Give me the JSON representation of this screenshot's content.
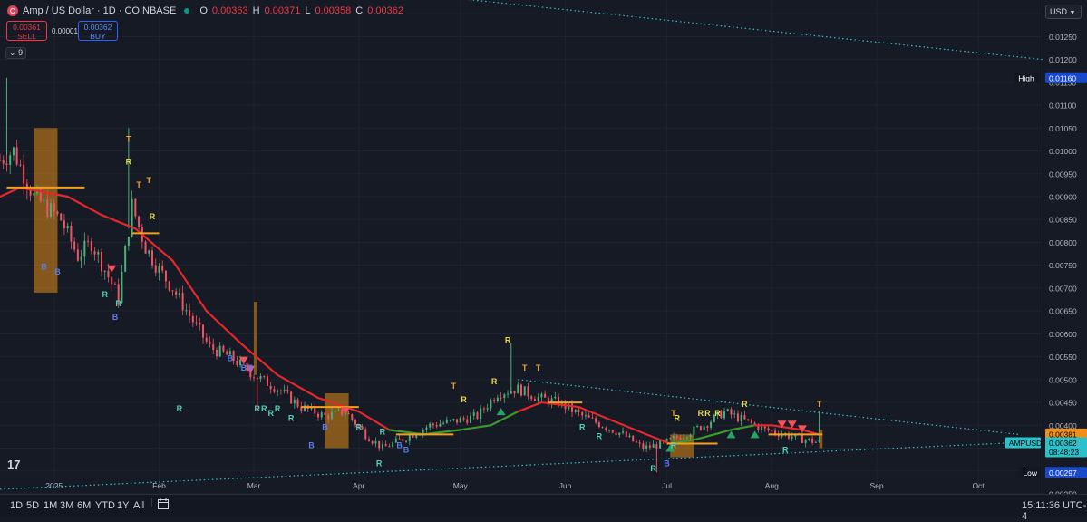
{
  "symbol": {
    "title": "Amp / US Dollar · 1D · COINBASE",
    "open_label": "O",
    "open": "0.00363",
    "high_label": "H",
    "high": "0.00371",
    "low_label": "L",
    "low": "0.00358",
    "close_label": "C",
    "close": "0.00362"
  },
  "trade": {
    "sell_price": "0.00361",
    "sell_label": "SELL",
    "spread": "0.00001",
    "buy_price": "0.00362",
    "buy_label": "BUY"
  },
  "indicator_count": "9",
  "currency_button": "USD",
  "colors": {
    "background": "#161a25",
    "up": "#4caf78",
    "down": "#f05463",
    "ma_down": "#e3282b",
    "ma_up": "#3a9a2a",
    "box": "#e08a16",
    "dotted": "#2ec0c8",
    "sell_marker": "#f0525e",
    "buy_marker": "#22a866"
  },
  "chart_data": {
    "type": "candlestick",
    "title": "Amp / US Dollar · 1D · COINBASE",
    "ylim": [
      0.0025,
      0.0133
    ],
    "x_range": [
      "2024-12-16",
      "2025-10-20"
    ],
    "grid": true,
    "y_ticks": [
      "0.01300",
      "0.01250",
      "0.01200",
      "0.01150",
      "0.01100",
      "0.01050",
      "0.01000",
      "0.00950",
      "0.00900",
      "0.00850",
      "0.00800",
      "0.00750",
      "0.00700",
      "0.00650",
      "0.00600",
      "0.00550",
      "0.00500",
      "0.00450",
      "0.00400",
      "0.00350",
      "0.00300",
      "0.00250"
    ],
    "x_ticks": [
      {
        "label": "2025",
        "date": "2025-01-01"
      },
      {
        "label": "Feb",
        "date": "2025-02-01"
      },
      {
        "label": "Mar",
        "date": "2025-03-01"
      },
      {
        "label": "Apr",
        "date": "2025-04-01"
      },
      {
        "label": "May",
        "date": "2025-05-01"
      },
      {
        "label": "Jun",
        "date": "2025-06-01"
      },
      {
        "label": "Jul",
        "date": "2025-07-01"
      },
      {
        "label": "Aug",
        "date": "2025-08-01"
      },
      {
        "label": "Sep",
        "date": "2025-09-01"
      },
      {
        "label": "Oct",
        "date": "2025-10-01"
      }
    ],
    "price_path": [
      [
        "2024-12-16",
        0.0098
      ],
      [
        "2024-12-20",
        0.01
      ],
      [
        "2024-12-26",
        0.009
      ],
      [
        "2025-01-03",
        0.0085
      ],
      [
        "2025-01-08",
        0.0077
      ],
      [
        "2025-01-12",
        0.008
      ],
      [
        "2025-01-16",
        0.0074
      ],
      [
        "2025-01-20",
        0.0068
      ],
      [
        "2025-01-24",
        0.0088
      ],
      [
        "2025-01-28",
        0.0079
      ],
      [
        "2025-02-01",
        0.0074
      ],
      [
        "2025-02-05",
        0.007
      ],
      [
        "2025-02-10",
        0.0064
      ],
      [
        "2025-02-16",
        0.0057
      ],
      [
        "2025-02-22",
        0.0055
      ],
      [
        "2025-03-01",
        0.0051
      ],
      [
        "2025-03-08",
        0.0048
      ],
      [
        "2025-03-15",
        0.0044
      ],
      [
        "2025-03-22",
        0.0042
      ],
      [
        "2025-03-28",
        0.0043
      ],
      [
        "2025-04-03",
        0.0038
      ],
      [
        "2025-04-08",
        0.0035
      ],
      [
        "2025-04-14",
        0.0037
      ],
      [
        "2025-04-22",
        0.004
      ],
      [
        "2025-04-30",
        0.0041
      ],
      [
        "2025-05-06",
        0.0042
      ],
      [
        "2025-05-12",
        0.0047
      ],
      [
        "2025-05-18",
        0.0048
      ],
      [
        "2025-05-24",
        0.0046
      ],
      [
        "2025-05-30",
        0.0045
      ],
      [
        "2025-06-06",
        0.0042
      ],
      [
        "2025-06-12",
        0.004
      ],
      [
        "2025-06-18",
        0.0038
      ],
      [
        "2025-06-24",
        0.0035
      ],
      [
        "2025-06-30",
        0.0036
      ],
      [
        "2025-07-06",
        0.0038
      ],
      [
        "2025-07-12",
        0.004
      ],
      [
        "2025-07-18",
        0.0043
      ],
      [
        "2025-07-24",
        0.0041
      ],
      [
        "2025-07-30",
        0.0039
      ],
      [
        "2025-08-05",
        0.0038
      ],
      [
        "2025-08-10",
        0.0037
      ],
      [
        "2025-08-15",
        0.00362
      ]
    ],
    "spikes": [
      {
        "date": "2024-12-18",
        "high": 0.0116
      },
      {
        "date": "2025-01-23",
        "high": 0.0105
      },
      {
        "date": "2025-03-02",
        "low": 0.0043
      },
      {
        "date": "2025-05-16",
        "high": 0.0058
      },
      {
        "date": "2025-06-28",
        "low": 0.00297
      },
      {
        "date": "2025-08-15",
        "high": 0.0043
      }
    ],
    "moving_average": [
      [
        "2024-12-16",
        0.009,
        "up"
      ],
      [
        "2024-12-22",
        0.0092,
        "down"
      ],
      [
        "2025-01-05",
        0.009,
        "down"
      ],
      [
        "2025-01-15",
        0.0086,
        "down"
      ],
      [
        "2025-01-25",
        0.0083,
        "down"
      ],
      [
        "2025-02-05",
        0.0076,
        "down"
      ],
      [
        "2025-02-15",
        0.0065,
        "down"
      ],
      [
        "2025-02-25",
        0.0058,
        "down"
      ],
      [
        "2025-03-08",
        0.0051,
        "down"
      ],
      [
        "2025-03-20",
        0.0046,
        "down"
      ],
      [
        "2025-04-01",
        0.0043,
        "down"
      ],
      [
        "2025-04-10",
        0.0039,
        "down"
      ],
      [
        "2025-04-20",
        0.0038,
        "up"
      ],
      [
        "2025-05-01",
        0.0039,
        "up"
      ],
      [
        "2025-05-10",
        0.004,
        "up"
      ],
      [
        "2025-05-18",
        0.0043,
        "up"
      ],
      [
        "2025-05-25",
        0.0045,
        "down"
      ],
      [
        "2025-06-05",
        0.0044,
        "down"
      ],
      [
        "2025-06-15",
        0.0041,
        "down"
      ],
      [
        "2025-06-25",
        0.0038,
        "down"
      ],
      [
        "2025-07-02",
        0.0036,
        "down"
      ],
      [
        "2025-07-10",
        0.0037,
        "up"
      ],
      [
        "2025-07-20",
        0.0039,
        "up"
      ],
      [
        "2025-07-27",
        0.004,
        "up"
      ],
      [
        "2025-08-01",
        0.004,
        "down"
      ],
      [
        "2025-08-10",
        0.0039,
        "down"
      ],
      [
        "2025-08-15",
        0.0038,
        "down"
      ]
    ],
    "shaded_boxes": [
      {
        "start": "2024-12-26",
        "end": "2025-01-02",
        "top": 0.0105,
        "bottom": 0.0069
      },
      {
        "start": "2025-03-01",
        "end": "2025-03-02",
        "top": 0.0067,
        "bottom": 0.0051
      },
      {
        "start": "2025-03-22",
        "end": "2025-03-29",
        "top": 0.0047,
        "bottom": 0.0035
      },
      {
        "start": "2025-07-02",
        "end": "2025-07-09",
        "top": 0.0038,
        "bottom": 0.0033
      },
      {
        "start": "2025-08-15",
        "end": "2025-08-16",
        "top": 0.0039,
        "bottom": 0.0035
      }
    ],
    "horizontal_levels": [
      {
        "start": "2024-12-18",
        "end": "2025-01-10",
        "value": 0.0092
      },
      {
        "start": "2025-01-24",
        "end": "2025-02-01",
        "value": 0.0082
      },
      {
        "start": "2025-03-15",
        "end": "2025-04-01",
        "value": 0.0044
      },
      {
        "start": "2025-04-12",
        "end": "2025-04-29",
        "value": 0.0038
      },
      {
        "start": "2025-05-27",
        "end": "2025-06-06",
        "value": 0.0045
      },
      {
        "start": "2025-07-01",
        "end": "2025-07-16",
        "value": 0.0036
      },
      {
        "start": "2025-07-31",
        "end": "2025-08-16",
        "value": 0.0038
      }
    ],
    "trendlines": [
      {
        "from": [
          "2025-03-01",
          0.0138
        ],
        "to": [
          "2025-10-20",
          0.012
        ]
      },
      {
        "from": [
          "2024-12-16",
          0.0026
        ],
        "to": [
          "2025-10-12",
          0.00362
        ]
      },
      {
        "from": [
          "2025-05-18",
          0.005
        ],
        "to": [
          "2025-10-13",
          0.0038
        ]
      }
    ],
    "signals": [
      {
        "text": "T",
        "date": "2025-01-23",
        "price": 0.0102,
        "color": "orange"
      },
      {
        "text": "R",
        "date": "2025-01-23",
        "price": 0.0097,
        "color": "yellow"
      },
      {
        "text": "T",
        "date": "2025-01-26",
        "price": 0.0092,
        "color": "orange"
      },
      {
        "text": "T",
        "date": "2025-01-29",
        "price": 0.0093,
        "color": "orange"
      },
      {
        "text": "R",
        "date": "2025-01-30",
        "price": 0.0085,
        "color": "yellow"
      },
      {
        "text": "B",
        "date": "2024-12-29",
        "price": 0.0074,
        "color": "blue"
      },
      {
        "text": "B",
        "date": "2025-01-02",
        "price": 0.0073,
        "color": "blue"
      },
      {
        "text": "R",
        "date": "2025-01-16",
        "price": 0.0068,
        "color": "cyan"
      },
      {
        "text": "R",
        "date": "2025-01-20",
        "price": 0.0066,
        "color": "cyan"
      },
      {
        "text": "B",
        "date": "2025-01-19",
        "price": 0.0063,
        "color": "blue"
      },
      {
        "text": "B",
        "date": "2025-02-22",
        "price": 0.0054,
        "color": "blue"
      },
      {
        "text": "B",
        "date": "2025-02-26",
        "price": 0.0052,
        "color": "blue"
      },
      {
        "text": "B",
        "date": "2025-02-28",
        "price": 0.0052,
        "color": "blue"
      },
      {
        "text": "R",
        "date": "2025-02-07",
        "price": 0.0043,
        "color": "cyan"
      },
      {
        "text": "R",
        "date": "2025-03-02",
        "price": 0.0043,
        "color": "cyan"
      },
      {
        "text": "R",
        "date": "2025-03-04",
        "price": 0.0043,
        "color": "cyan"
      },
      {
        "text": "R",
        "date": "2025-03-06",
        "price": 0.0042,
        "color": "cyan"
      },
      {
        "text": "R",
        "date": "2025-03-08",
        "price": 0.0043,
        "color": "cyan"
      },
      {
        "text": "R",
        "date": "2025-03-12",
        "price": 0.0041,
        "color": "cyan"
      },
      {
        "text": "B",
        "date": "2025-03-22",
        "price": 0.0039,
        "color": "blue"
      },
      {
        "text": "B",
        "date": "2025-03-18",
        "price": 0.0035,
        "color": "blue"
      },
      {
        "text": "R",
        "date": "2025-04-01",
        "price": 0.0039,
        "color": "cyan"
      },
      {
        "text": "R",
        "date": "2025-04-08",
        "price": 0.0038,
        "color": "cyan"
      },
      {
        "text": "B",
        "date": "2025-04-13",
        "price": 0.0035,
        "color": "blue"
      },
      {
        "text": "B",
        "date": "2025-04-15",
        "price": 0.0034,
        "color": "blue"
      },
      {
        "text": "R",
        "date": "2025-04-07",
        "price": 0.0031,
        "color": "cyan"
      },
      {
        "text": "T",
        "date": "2025-04-29",
        "price": 0.0048,
        "color": "orange"
      },
      {
        "text": "R",
        "date": "2025-05-02",
        "price": 0.0045,
        "color": "yellow"
      },
      {
        "text": "R",
        "date": "2025-05-11",
        "price": 0.0049,
        "color": "yellow"
      },
      {
        "text": "R",
        "date": "2025-05-15",
        "price": 0.0058,
        "color": "yellow"
      },
      {
        "text": "T",
        "date": "2025-05-20",
        "price": 0.0052,
        "color": "orange"
      },
      {
        "text": "T",
        "date": "2025-05-24",
        "price": 0.0052,
        "color": "orange"
      },
      {
        "text": "R",
        "date": "2025-06-06",
        "price": 0.0039,
        "color": "cyan"
      },
      {
        "text": "R",
        "date": "2025-06-11",
        "price": 0.0037,
        "color": "cyan"
      },
      {
        "text": "R",
        "date": "2025-06-27",
        "price": 0.003,
        "color": "cyan"
      },
      {
        "text": "R",
        "date": "2025-07-03",
        "price": 0.0035,
        "color": "cyan"
      },
      {
        "text": "B",
        "date": "2025-07-01",
        "price": 0.0031,
        "color": "blue"
      },
      {
        "text": "T",
        "date": "2025-07-03",
        "price": 0.0042,
        "color": "orange"
      },
      {
        "text": "R",
        "date": "2025-07-04",
        "price": 0.0041,
        "color": "yellow"
      },
      {
        "text": "R",
        "date": "2025-07-11",
        "price": 0.0042,
        "color": "yellow"
      },
      {
        "text": "R",
        "date": "2025-07-13",
        "price": 0.0042,
        "color": "yellow"
      },
      {
        "text": "R",
        "date": "2025-07-16",
        "price": 0.0042,
        "color": "yellow"
      },
      {
        "text": "R",
        "date": "2025-07-24",
        "price": 0.0044,
        "color": "yellow"
      },
      {
        "text": "R",
        "date": "2025-08-05",
        "price": 0.0034,
        "color": "cyan"
      },
      {
        "text": "T",
        "date": "2025-08-15",
        "price": 0.0044,
        "color": "orange"
      }
    ],
    "sell_markers": [
      {
        "date": "2025-01-18",
        "price": 0.0074
      },
      {
        "date": "2025-02-26",
        "price": 0.0054
      },
      {
        "date": "2025-02-28",
        "price": 0.0052
      },
      {
        "date": "2025-03-28",
        "price": 0.0043
      },
      {
        "date": "2025-08-04",
        "price": 0.004
      },
      {
        "date": "2025-08-07",
        "price": 0.004
      },
      {
        "date": "2025-08-10",
        "price": 0.0039
      }
    ],
    "buy_markers": [
      {
        "date": "2025-05-13",
        "price": 0.0043
      },
      {
        "date": "2025-07-02",
        "price": 0.0035
      },
      {
        "date": "2025-07-20",
        "price": 0.0038
      },
      {
        "date": "2025-07-27",
        "price": 0.0038
      }
    ],
    "price_labels": [
      {
        "label": "High",
        "value": "0.01160",
        "price": 0.0116,
        "bg": "#1848cc"
      },
      {
        "label": "",
        "value": "0.00381",
        "price": 0.00381,
        "bg": "#ef8e19"
      },
      {
        "label": "AMPUSD",
        "value": "0.00362",
        "sub": "08:48:23",
        "price": 0.00362,
        "bg": "#2ec0c8"
      },
      {
        "label": "Low",
        "value": "0.00297",
        "price": 0.00297,
        "bg": "#1848cc"
      }
    ]
  },
  "timeframes": [
    "1D",
    "5D",
    "1M",
    "3M",
    "6M",
    "YTD",
    "1Y",
    "All"
  ],
  "clock": "15:11:36 UTC-4",
  "tv_logo": "17"
}
